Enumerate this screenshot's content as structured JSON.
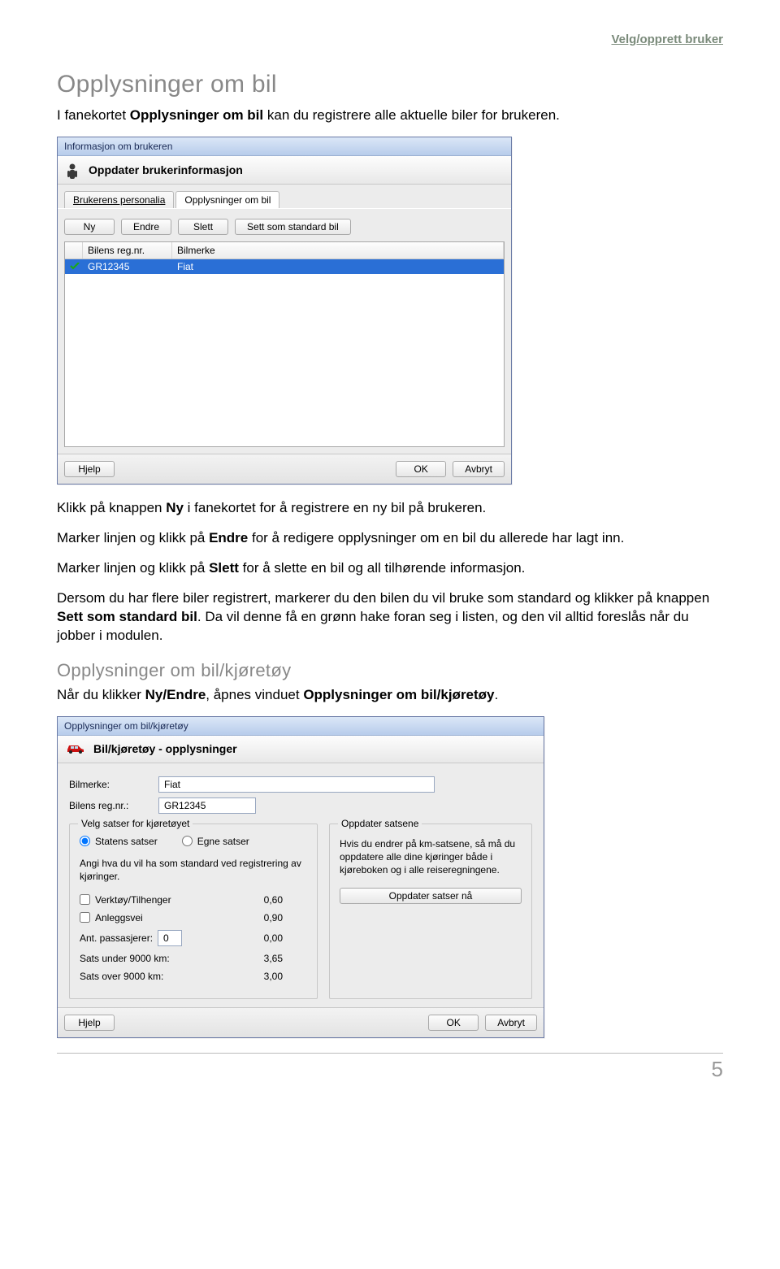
{
  "header": {
    "right": "Velg/opprett bruker"
  },
  "section1": {
    "title": "Opplysninger om bil",
    "p1a": "I fanekortet ",
    "p1b": "Opplysninger om bil",
    "p1c": " kan du registrere alle aktuelle biler for brukeren."
  },
  "win1": {
    "title": "Informasjon om brukeren",
    "strip": "Oppdater brukerinformasjon",
    "tabs": {
      "t1": "Brukerens personalia",
      "t2": "Opplysninger om bil"
    },
    "toolbar": {
      "ny": "Ny",
      "endre": "Endre",
      "slett": "Slett",
      "sett": "Sett som standard bil"
    },
    "list": {
      "headers": {
        "reg": "Bilens reg.nr.",
        "merke": "Bilmerke"
      },
      "rows": [
        {
          "reg": "GR12345",
          "merke": "Fiat",
          "checked": true
        }
      ]
    },
    "bottom": {
      "hjelp": "Hjelp",
      "ok": "OK",
      "avbryt": "Avbryt"
    }
  },
  "para2": {
    "a": "Klikk på knappen ",
    "b": "Ny",
    "c": " i fanekortet for å registrere en ny bil på brukeren."
  },
  "para3": {
    "a": "Marker linjen og klikk på ",
    "b": "Endre",
    "c": " for å redigere opplysninger om en bil du allerede har lagt inn."
  },
  "para4": {
    "a": "Marker linjen og klikk på ",
    "b": "Slett",
    "c": " for å slette en bil og all tilhørende informasjon."
  },
  "para5": {
    "a": "Dersom du har flere biler registrert, markerer du den bilen du vil bruke som standard og klikker på knappen ",
    "b": "Sett som standard bil",
    "c": ". Da vil denne få en grønn hake foran seg i listen, og den vil alltid foreslås når du jobber i modulen."
  },
  "section2": {
    "title": "Opplysninger om bil/kjøretøy",
    "p1a": "Når du klikker ",
    "p1b": "Ny/Endre",
    "p1c": ", åpnes vinduet ",
    "p1d": "Opplysninger om bil/kjøretøy",
    "p1e": "."
  },
  "win2": {
    "title": "Opplysninger om bil/kjøretøy",
    "strip": "Bil/kjøretøy - opplysninger",
    "lbl_merke": "Bilmerke:",
    "val_merke": "Fiat",
    "lbl_reg": "Bilens reg.nr.:",
    "val_reg": "GR12345",
    "grp_left": "Velg satser for kjøretøyet",
    "opt_stat": "Statens satser",
    "opt_egne": "Egne satser",
    "left_note": "Angi hva du vil ha som standard ved registrering av kjøringer.",
    "row_verktoy": "Verktøy/Tilhenger",
    "row_anlegg": "Anleggsvei",
    "row_pass": "Ant. passasjerer:",
    "val_pass_input": "0",
    "row_under": "Sats under 9000 km:",
    "row_over": "Sats over 9000 km:",
    "rate_verktoy": "0,60",
    "rate_anlegg": "0,90",
    "rate_pass": "0,00",
    "rate_under": "3,65",
    "rate_over": "3,00",
    "grp_right": "Oppdater satsene",
    "right_note": "Hvis du endrer på km-satsene, så må du oppdatere alle dine kjøringer både i kjøreboken og i alle reiseregningene.",
    "btn_oppdater": "Oppdater satser nå",
    "bottom": {
      "hjelp": "Hjelp",
      "ok": "OK",
      "avbryt": "Avbryt"
    }
  },
  "page_number": "5"
}
